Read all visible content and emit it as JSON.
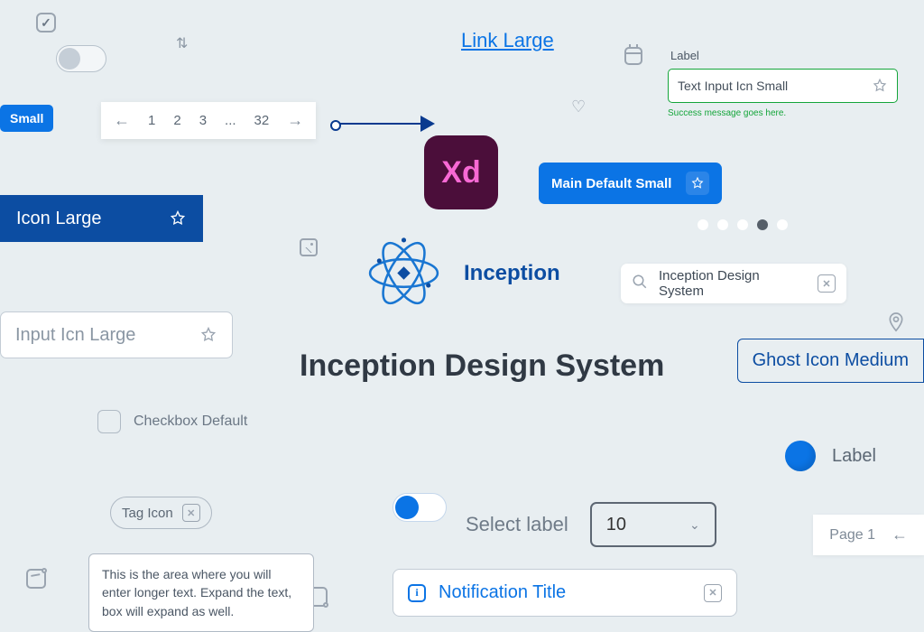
{
  "link_large": "Link Large",
  "label_top_right": "Label",
  "text_input_success": {
    "value": "Text Input Icn Small",
    "success_msg": "Success message goes here."
  },
  "btn_small": "Small",
  "btn_main_small": "Main Default Small",
  "icon_large_btn": "Icon Large",
  "inception_brand": "Inception",
  "search_value": "Inception Design System",
  "input_large_placeholder": "Input Icn Large",
  "ghost_btn": "Ghost Icon Medium",
  "headline": "Inception Design System",
  "checkbox_default_label": "Checkbox Default",
  "tag_chip": "Tag Icon",
  "select": {
    "label": "Select label",
    "value": "10"
  },
  "legend_label": "Label",
  "pagination": {
    "pages": [
      "1",
      "2",
      "3",
      "...",
      "32"
    ]
  },
  "textarea_text": "This is the area where you will enter longer text. Expand the text, box will expand as well.",
  "notification_title": "Notification Title",
  "page_stepper": "Page 1",
  "xd_label": "Xd",
  "carousel_active_index": 3
}
